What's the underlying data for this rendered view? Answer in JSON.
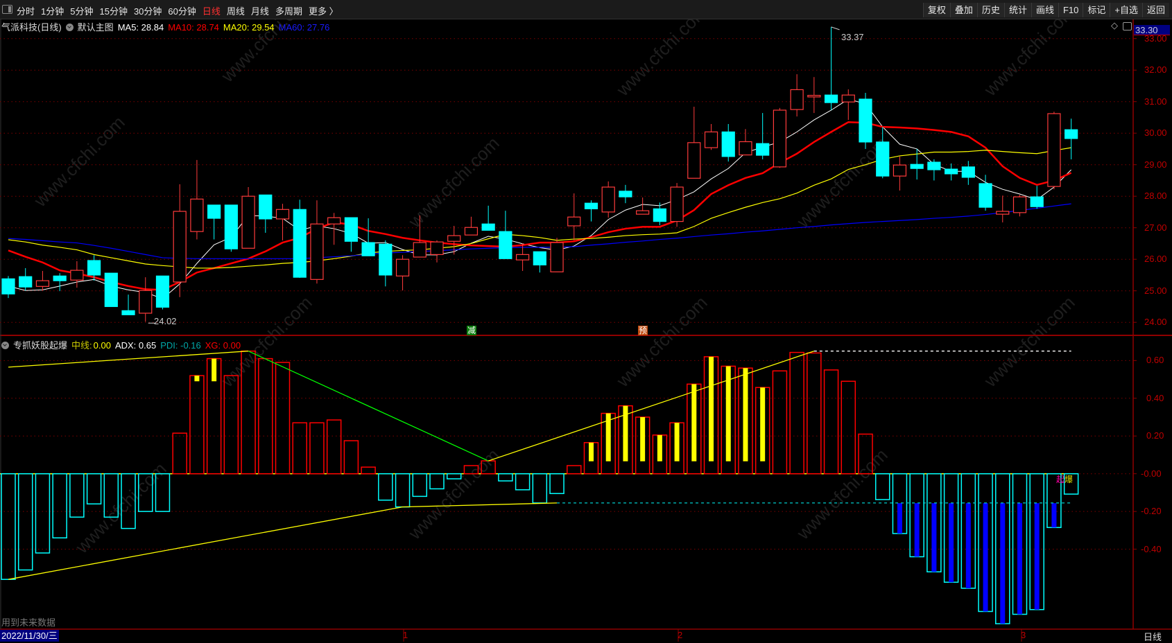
{
  "toolbar": {
    "periods": [
      "分时",
      "1分钟",
      "5分钟",
      "15分钟",
      "30分钟",
      "60分钟",
      "日线",
      "周线",
      "月线",
      "多周期",
      "更多 〉"
    ],
    "active_period": "日线",
    "actions": [
      "复权",
      "叠加",
      "历史",
      "统计",
      "画线",
      "F10",
      "标记",
      "+自选",
      "返回"
    ]
  },
  "main_legend": {
    "stock": "气派科技(日线)",
    "template": "默认主图",
    "ma5": "MA5: 28.84",
    "ma10": "MA10: 28.74",
    "ma20": "MA20: 29.54",
    "ma60": "MA60: 27.76"
  },
  "indicator_legend": {
    "name": "专抓妖股起爆",
    "mid_label": "中线:",
    "mid_value": "0.00",
    "adx": "ADX: 0.65",
    "pdi": "PDI: -0.16",
    "xg": "XG: 0.00"
  },
  "price_axis": {
    "current": "33.30",
    "labels": [
      "33.00",
      "32.00",
      "31.00",
      "30.00",
      "29.00",
      "28.00",
      "27.00",
      "26.00",
      "25.00",
      "24.00"
    ]
  },
  "indicator_axis": {
    "labels": [
      "0.60",
      "0.40",
      "0.20",
      "-0.00",
      "-0.20",
      "-0.40"
    ]
  },
  "annotations": {
    "high": "33.37",
    "low": "24.02"
  },
  "signals": {
    "reduce": "减",
    "warn": "预",
    "burst": [
      "起",
      "爆"
    ]
  },
  "footer": {
    "note": "用到未来数据",
    "date": "2022/11/30/三",
    "ticks": [
      "1",
      "2",
      "3"
    ],
    "period": "日线"
  },
  "watermark": "www.cfchi.com",
  "colors": {
    "up": "#ff3b3b",
    "down": "#00ffff",
    "ma5": "#ffffff",
    "ma10": "#ff0000",
    "ma20": "#ffff00",
    "ma60": "#0000ff",
    "grid": "#800000",
    "axis": "#c00000"
  },
  "chart_data": [
    {
      "type": "candlestick",
      "ylim": [
        24,
        33
      ],
      "columns": [
        "open",
        "high",
        "low",
        "close"
      ],
      "candles": [
        [
          25.38,
          25.47,
          24.77,
          24.9
        ],
        [
          25.45,
          25.72,
          25.01,
          25.12
        ],
        [
          25.14,
          25.63,
          25.01,
          25.32
        ],
        [
          25.47,
          25.56,
          24.99,
          25.32
        ],
        [
          25.34,
          25.94,
          25.1,
          25.65
        ],
        [
          25.96,
          26.13,
          25.32,
          25.5
        ],
        [
          25.56,
          25.56,
          24.5,
          24.5
        ],
        [
          24.37,
          24.88,
          24.24,
          24.24
        ],
        [
          24.29,
          25.43,
          24.02,
          25.01
        ],
        [
          25.47,
          25.47,
          24.41,
          24.48
        ],
        [
          25.28,
          28.38,
          24.8,
          27.52
        ],
        [
          26.88,
          29.15,
          26.63,
          27.91
        ],
        [
          27.72,
          27.72,
          26.63,
          27.3
        ],
        [
          27.72,
          27.72,
          26.24,
          26.33
        ],
        [
          26.35,
          28.29,
          26.35,
          28.0
        ],
        [
          28.04,
          28.04,
          26.84,
          27.28
        ],
        [
          27.28,
          27.76,
          26.6,
          27.58
        ],
        [
          27.58,
          27.89,
          25.41,
          25.43
        ],
        [
          25.36,
          27.87,
          25.23,
          27.12
        ],
        [
          27.12,
          27.47,
          26.46,
          27.32
        ],
        [
          27.32,
          27.32,
          26.24,
          26.57
        ],
        [
          26.53,
          27.3,
          26.11,
          26.11
        ],
        [
          26.48,
          26.6,
          25.14,
          25.5
        ],
        [
          25.47,
          26.13,
          25.01,
          26.0
        ],
        [
          26.07,
          27.39,
          26.07,
          26.53
        ],
        [
          26.15,
          26.6,
          25.9,
          26.55
        ],
        [
          26.57,
          27.06,
          26.15,
          26.75
        ],
        [
          26.77,
          27.35,
          26.77,
          27.01
        ],
        [
          27.12,
          27.7,
          26.92,
          26.92
        ],
        [
          26.88,
          27.54,
          26.02,
          26.02
        ],
        [
          25.98,
          26.5,
          25.63,
          26.15
        ],
        [
          26.24,
          26.24,
          25.58,
          25.82
        ],
        [
          25.6,
          26.68,
          25.6,
          26.53
        ],
        [
          27.06,
          28.09,
          26.6,
          27.34
        ],
        [
          27.78,
          27.87,
          27.2,
          27.6
        ],
        [
          27.5,
          28.47,
          27.32,
          28.29
        ],
        [
          28.16,
          28.36,
          27.78,
          27.98
        ],
        [
          27.43,
          27.96,
          27.43,
          27.54
        ],
        [
          27.6,
          27.8,
          27.08,
          27.2
        ],
        [
          27.2,
          28.42,
          27.03,
          28.29
        ],
        [
          28.57,
          30.84,
          28.57,
          29.7
        ],
        [
          29.54,
          30.29,
          29.47,
          30.04
        ],
        [
          30.04,
          30.29,
          29.1,
          29.26
        ],
        [
          29.31,
          30.13,
          29.31,
          29.73
        ],
        [
          29.67,
          30.64,
          29.17,
          29.3
        ],
        [
          28.93,
          30.8,
          28.9,
          30.73
        ],
        [
          30.75,
          31.87,
          30.53,
          31.38
        ],
        [
          31.15,
          31.78,
          30.64,
          31.2
        ],
        [
          31.21,
          33.37,
          30.73,
          30.97
        ],
        [
          30.99,
          31.39,
          30.42,
          31.21
        ],
        [
          31.08,
          31.28,
          29.5,
          29.72
        ],
        [
          29.72,
          30.2,
          28.57,
          28.64
        ],
        [
          28.64,
          29.26,
          28.18,
          28.99
        ],
        [
          29.01,
          29.5,
          28.53,
          28.88
        ],
        [
          29.08,
          29.17,
          28.5,
          28.84
        ],
        [
          28.86,
          29.04,
          28.5,
          28.71
        ],
        [
          28.93,
          29.12,
          28.36,
          28.6
        ],
        [
          28.4,
          28.68,
          27.54,
          27.65
        ],
        [
          27.43,
          28.02,
          27.17,
          27.52
        ],
        [
          27.48,
          28.04,
          27.36,
          27.98
        ],
        [
          27.98,
          28.33,
          27.6,
          27.67
        ],
        [
          28.31,
          30.68,
          28.22,
          30.62
        ],
        [
          30.11,
          30.46,
          29.17,
          29.83
        ]
      ],
      "series": [
        {
          "name": "MA5",
          "values": [
            25.15,
            25.01,
            25.03,
            25.15,
            25.28,
            25.36,
            25.15,
            25.03,
            24.95,
            24.75,
            25.22,
            25.87,
            26.46,
            26.7,
            27.39,
            27.37,
            27.3,
            26.92,
            27.06,
            26.97,
            26.82,
            26.51,
            26.53,
            26.31,
            26.14,
            26.14,
            26.24,
            26.51,
            26.73,
            26.64,
            26.49,
            26.37,
            26.29,
            26.42,
            26.75,
            27.26,
            27.56,
            27.74,
            27.7,
            27.89,
            28.14,
            28.55,
            28.88,
            29.38,
            29.56,
            29.72,
            30.04,
            30.42,
            30.73,
            31.08,
            30.93,
            30.2,
            29.65,
            29.5,
            29.01,
            28.79,
            28.79,
            28.44,
            28.22,
            28.07,
            27.89,
            28.29,
            28.84
          ]
        },
        {
          "name": "MA10",
          "values": [
            26.28,
            26.08,
            25.9,
            25.65,
            25.55,
            25.43,
            25.28,
            25.15,
            25.05,
            25.03,
            25.28,
            25.58,
            25.72,
            25.87,
            26.02,
            26.25,
            26.53,
            26.68,
            26.97,
            27.17,
            27.1,
            26.9,
            26.8,
            26.68,
            26.6,
            26.53,
            26.48,
            26.44,
            26.42,
            26.4,
            26.45,
            26.53,
            26.53,
            26.57,
            26.7,
            26.86,
            26.97,
            27.03,
            27.03,
            27.23,
            27.56,
            28.07,
            28.35,
            28.58,
            28.73,
            29.06,
            29.35,
            29.72,
            30.04,
            30.35,
            30.33,
            30.2,
            30.18,
            30.15,
            30.1,
            30.04,
            29.9,
            29.54,
            28.95,
            28.58,
            28.36,
            28.5,
            28.74
          ]
        },
        {
          "name": "MA20",
          "values": [
            26.62,
            26.55,
            26.45,
            26.38,
            26.3,
            26.15,
            26.05,
            25.95,
            25.85,
            25.8,
            25.76,
            25.72,
            25.72,
            25.74,
            25.78,
            25.82,
            25.87,
            25.9,
            25.95,
            26.02,
            26.1,
            26.2,
            26.25,
            26.28,
            26.3,
            26.35,
            26.4,
            26.5,
            26.65,
            26.79,
            26.75,
            26.69,
            26.6,
            26.64,
            26.66,
            26.7,
            26.75,
            26.78,
            26.8,
            26.84,
            27.04,
            27.3,
            27.48,
            27.65,
            27.8,
            27.92,
            28.1,
            28.35,
            28.55,
            28.85,
            29.0,
            29.17,
            29.28,
            29.34,
            29.4,
            29.4,
            29.42,
            29.46,
            29.42,
            29.38,
            29.35,
            29.45,
            29.54
          ]
        },
        {
          "name": "MA60",
          "values": [
            26.66,
            26.63,
            26.59,
            26.55,
            26.52,
            26.44,
            26.35,
            26.25,
            26.15,
            26.05,
            26.03,
            26.02,
            26.02,
            26.02,
            26.02,
            26.02,
            26.02,
            26.02,
            26.05,
            26.08,
            26.11,
            26.16,
            26.2,
            26.22,
            26.25,
            26.27,
            26.3,
            26.33,
            26.35,
            26.37,
            26.38,
            26.38,
            26.38,
            26.4,
            26.45,
            26.49,
            26.54,
            26.58,
            26.63,
            26.67,
            26.72,
            26.77,
            26.81,
            26.86,
            26.9,
            26.95,
            27.0,
            27.04,
            27.09,
            27.13,
            27.17,
            27.2,
            27.23,
            27.26,
            27.3,
            27.33,
            27.37,
            27.42,
            27.48,
            27.55,
            27.62,
            27.69,
            27.76
          ]
        }
      ],
      "signals": [
        {
          "candle": 28,
          "label": "减"
        },
        {
          "candle": 38,
          "label": "预"
        }
      ]
    },
    {
      "type": "bar",
      "name": "专抓妖股起爆",
      "ylim": [
        -0.85,
        0.72
      ],
      "values": [
        -0.56,
        -0.51,
        -0.42,
        -0.34,
        -0.23,
        -0.16,
        -0.23,
        -0.29,
        -0.2,
        -0.2,
        0.215,
        0.52,
        0.61,
        0.52,
        0.65,
        0.61,
        0.59,
        0.27,
        0.27,
        0.285,
        0.175,
        0.035,
        -0.14,
        -0.176,
        -0.12,
        -0.08,
        -0.027,
        0.043,
        0.068,
        -0.038,
        -0.085,
        -0.155,
        -0.105,
        0.043,
        0.165,
        0.32,
        0.36,
        0.3,
        0.205,
        0.27,
        0.475,
        0.62,
        0.57,
        0.56,
        0.457,
        0.545,
        0.643,
        0.64,
        0.55,
        0.49,
        0.21,
        -0.137,
        -0.317,
        -0.44,
        -0.52,
        -0.575,
        -0.607,
        -0.73,
        -0.795,
        -0.745,
        -0.72,
        -0.285,
        -0.108
      ],
      "yellow_bars": [
        [
          12,
          0.49,
          0.52
        ],
        [
          13,
          0.49,
          0.61
        ],
        [
          35,
          0.066,
          0.165
        ],
        [
          36,
          0.066,
          0.32
        ],
        [
          37,
          0.066,
          0.36
        ],
        [
          38,
          0.066,
          0.3
        ],
        [
          39,
          0.066,
          0.205
        ],
        [
          40,
          0.066,
          0.27
        ],
        [
          41,
          0.066,
          0.475
        ],
        [
          42,
          0.066,
          0.62
        ],
        [
          43,
          0.066,
          0.57
        ],
        [
          44,
          0.066,
          0.56
        ],
        [
          45,
          0.066,
          0.457
        ]
      ],
      "blue_bars": [
        [
          53,
          -0.317,
          -0.156
        ],
        [
          54,
          -0.44,
          -0.156
        ],
        [
          55,
          -0.52,
          -0.156
        ],
        [
          56,
          -0.575,
          -0.156
        ],
        [
          57,
          -0.607,
          -0.156
        ],
        [
          58,
          -0.73,
          -0.156
        ],
        [
          59,
          -0.795,
          -0.156
        ],
        [
          60,
          -0.745,
          -0.156
        ],
        [
          61,
          -0.72,
          -0.156
        ],
        [
          62,
          -0.285,
          -0.156
        ]
      ],
      "lines": [
        {
          "color": "#ffff00",
          "style": "solid",
          "points": [
            [
              1,
              0.565
            ],
            [
              15,
              0.65
            ]
          ]
        },
        {
          "color": "#00ff00",
          "style": "solid",
          "points": [
            [
              15,
              0.65
            ],
            [
              29,
              0.068
            ]
          ]
        },
        {
          "color": "#ffff00",
          "style": "solid",
          "points": [
            [
              29,
              0.068
            ],
            [
              48,
              0.65
            ]
          ]
        },
        {
          "color": "#ffffff",
          "style": "dashed",
          "points": [
            [
              48,
              0.65
            ],
            [
              63,
              0.65
            ]
          ]
        },
        {
          "color": "#ffff00",
          "style": "solid",
          "points": [
            [
              1,
              -0.56
            ],
            [
              24,
              -0.176
            ],
            [
              33,
              -0.155
            ]
          ]
        },
        {
          "color": "#00cccc",
          "style": "dashed",
          "points": [
            [
              33,
              -0.155
            ],
            [
              63,
              -0.155
            ]
          ]
        }
      ],
      "signals": [
        {
          "candle": 62,
          "label": "起爆"
        }
      ]
    }
  ]
}
